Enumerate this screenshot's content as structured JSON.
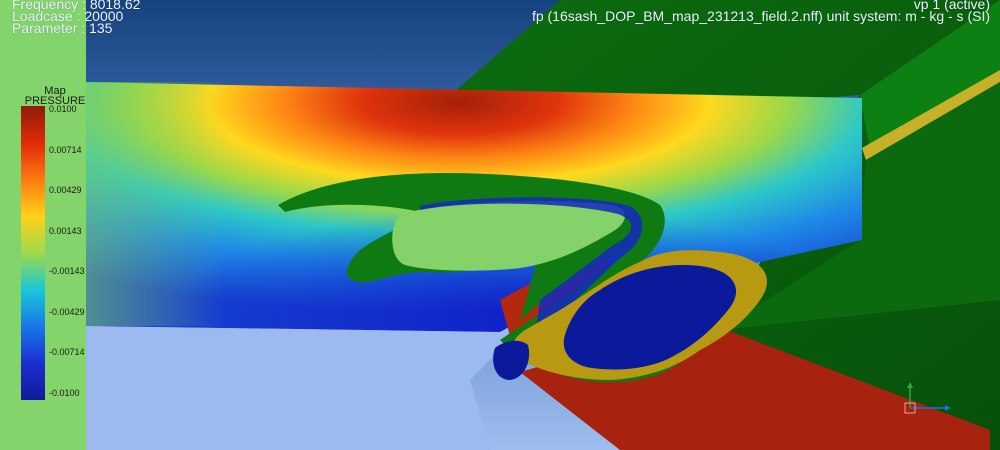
{
  "hud": {
    "frequency": "Frequency : 8018.62",
    "loadcase": "Loadcase : 20000",
    "parameter": "Parameter : 135",
    "viewport": "vp 1 (active)",
    "file_info": "fp (16sash_DOP_BM_map_231213_field.2.nff) unit system: m - kg - s (SI)"
  },
  "legend": {
    "title": "Map",
    "subtitle": "PRESSURE",
    "ticks": [
      "0.0100",
      "0.00714",
      "0.00429",
      "0.00143",
      "-0.00143",
      "-0.00429",
      "-0.00714",
      "-0.0100"
    ],
    "colors": [
      "#8e1c0a",
      "#e02a0a",
      "#ff7a10",
      "#ffd21a",
      "#9fd94a",
      "#18c8d8",
      "#1878e8",
      "#1b2fd0",
      "#101a9a"
    ]
  },
  "scene": {
    "background_top": "#1a4a8a",
    "background_bottom": "#8fb2e8",
    "profile_color": "#0e7a12",
    "lower_profile_color": "#a82210",
    "seal_color": "#b89a10",
    "core_color": "#0a1a9a"
  }
}
